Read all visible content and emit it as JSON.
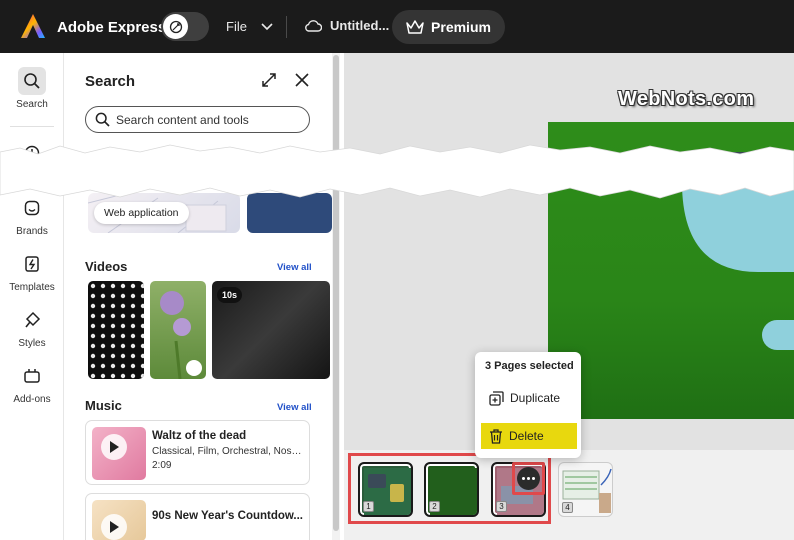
{
  "header": {
    "app_name": "Adobe Express",
    "file_label": "File",
    "doc_title": "Untitled...",
    "premium_label": "Premium"
  },
  "rail": {
    "items": [
      {
        "label": "Search",
        "icon": "search-icon"
      },
      {
        "label": "",
        "icon": "clock-icon"
      },
      {
        "label": "Brands",
        "icon": "brand-icon"
      },
      {
        "label": "Templates",
        "icon": "templates-icon"
      },
      {
        "label": "Styles",
        "icon": "styles-icon"
      },
      {
        "label": "Add-ons",
        "icon": "addons-icon"
      }
    ]
  },
  "panel": {
    "title": "Search",
    "search_placeholder": "Search content and tools",
    "web_app_label": "Web application",
    "videos_heading": "Videos",
    "videos_view_all": "View all",
    "video_badge": "10s",
    "music_heading": "Music",
    "music_view_all": "View all",
    "music": [
      {
        "title": "Waltz of the dead",
        "tags": "Classical, Film, Orchestral, Nostal...",
        "duration": "2:09"
      },
      {
        "title": "90s New Year's Countdow...",
        "tags": "",
        "duration": ""
      }
    ]
  },
  "canvas": {
    "watermark": "WebNots.com"
  },
  "pages": {
    "numbers": [
      "1",
      "2",
      "3",
      "4"
    ],
    "selected_count_label": "3 Pages selected",
    "duplicate_label": "Duplicate",
    "delete_label": "Delete"
  },
  "colors": {
    "topbar": "#1b1b1b",
    "highlight": "#e0494b",
    "delete_bg": "#e8d80e",
    "design_green": "#2e8d1a",
    "link_blue": "#2050c8"
  }
}
